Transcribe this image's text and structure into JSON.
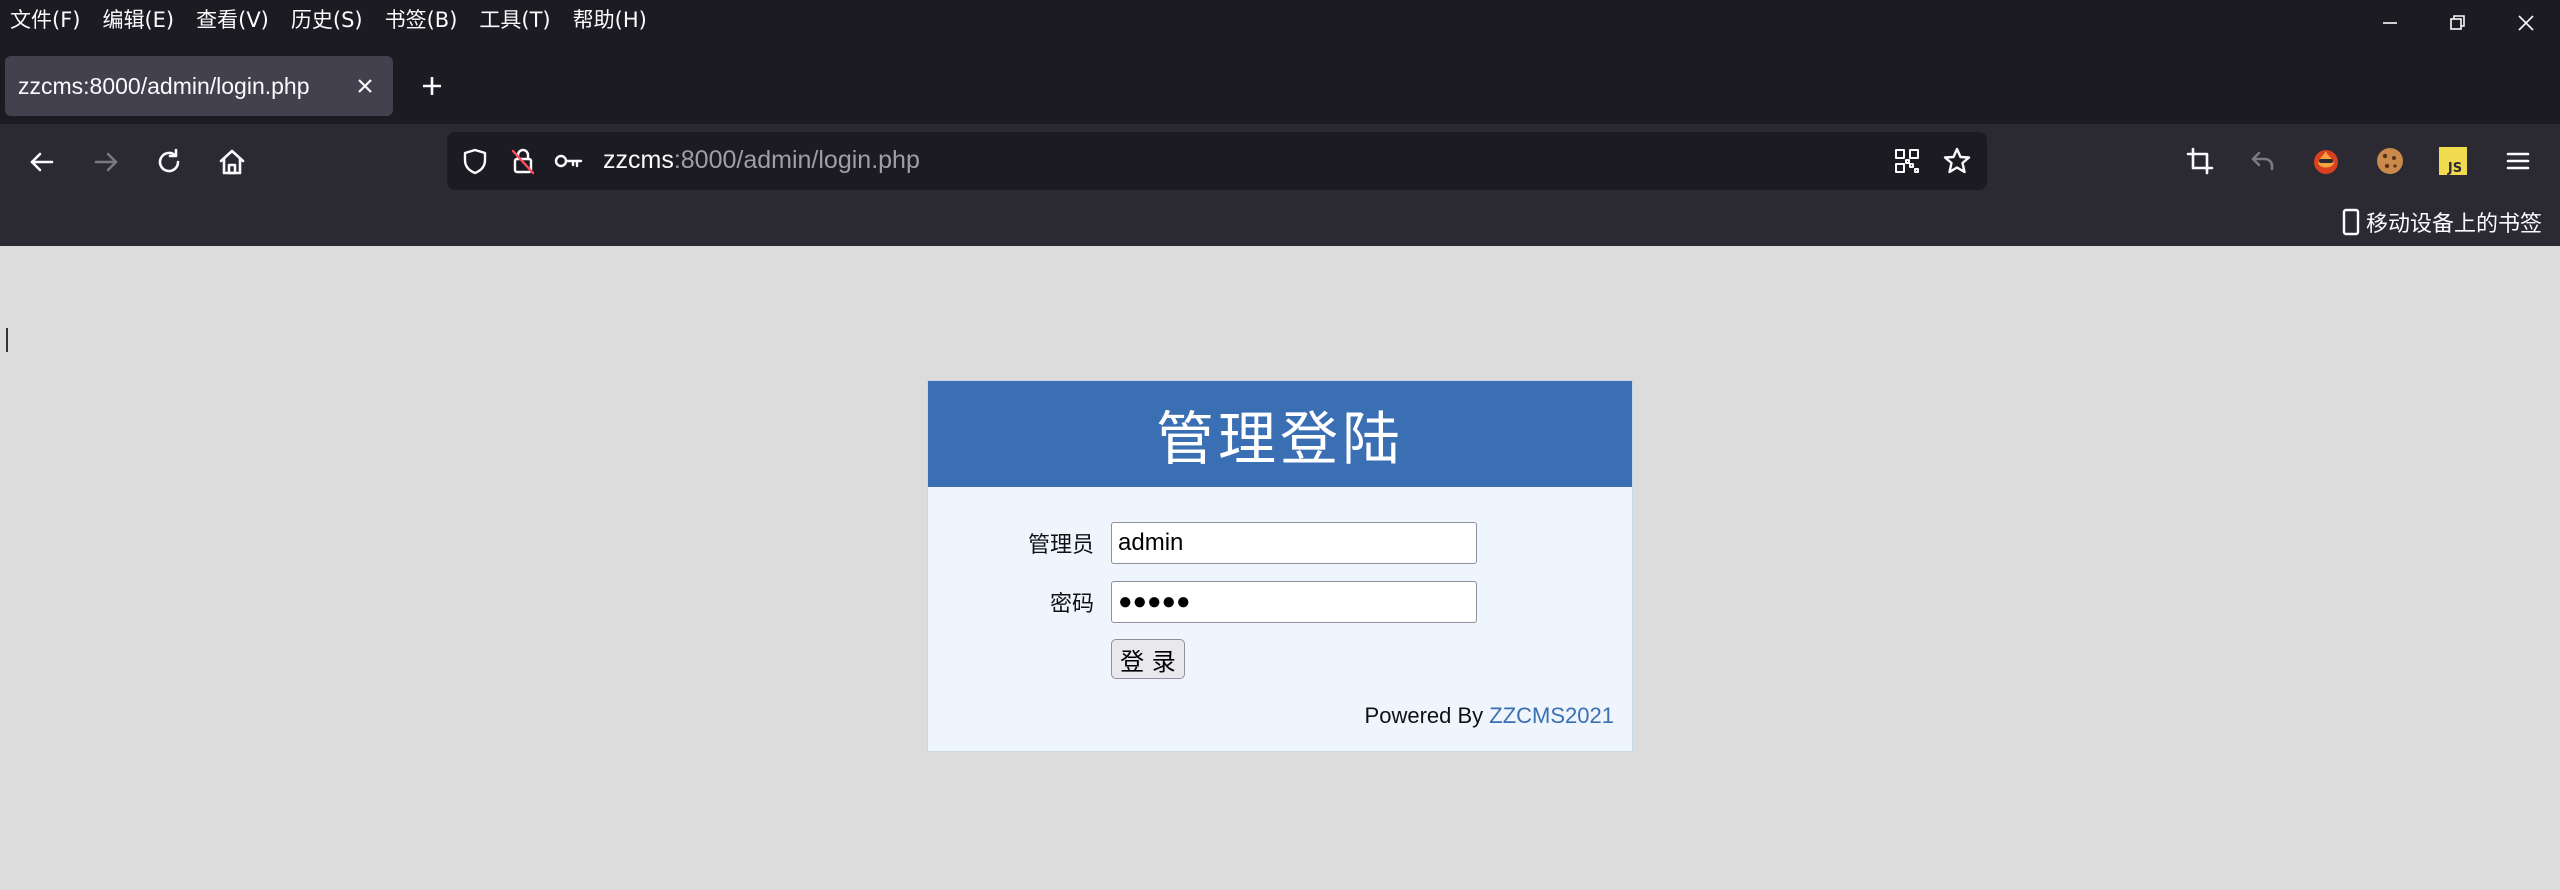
{
  "menubar": {
    "items": [
      "文件(F)",
      "编辑(E)",
      "查看(V)",
      "历史(S)",
      "书签(B)",
      "工具(T)",
      "帮助(H)"
    ]
  },
  "tab": {
    "title": "zzcms:8000/admin/login.php"
  },
  "urlbar": {
    "host": "zzcms",
    "path": ":8000/admin/login.php"
  },
  "bookmarks": {
    "mobile_label": "移动设备上的书签"
  },
  "login": {
    "title": "管理登陆",
    "username_label": "管理员",
    "username_value": "admin",
    "password_label": "密码",
    "password_value": "●●●●●",
    "submit_label": "登 录",
    "powered_prefix": "Powered By",
    "powered_link": "ZZCMS2021"
  },
  "colors": {
    "header_blue": "#3b6fb4",
    "form_bg": "#eff5fd",
    "page_bg": "#dcdcdc",
    "chrome_dark": "#1c1b22"
  },
  "icons": [
    "back-arrow-icon",
    "forward-arrow-icon",
    "reload-icon",
    "home-icon",
    "shield-icon",
    "lock-icon",
    "key-icon",
    "qr-code-icon",
    "star-icon",
    "crop-icon",
    "undo-icon",
    "extension-fire-icon",
    "cookie-icon",
    "js-icon",
    "hamburger-menu-icon",
    "mobile-device-icon"
  ]
}
